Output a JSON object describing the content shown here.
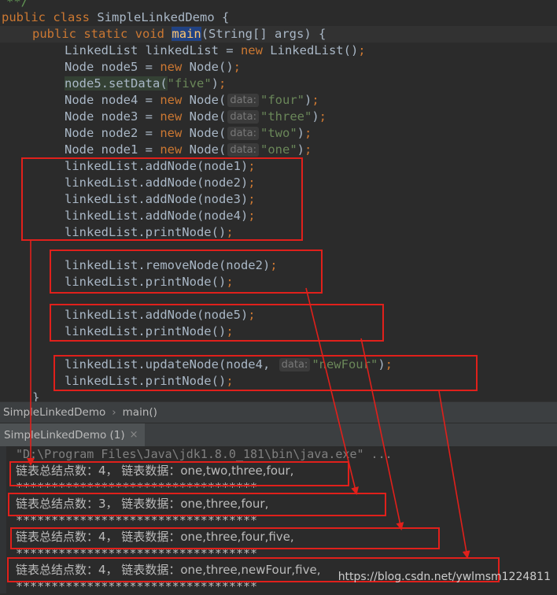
{
  "editor": {
    "comment_tail": "**/",
    "class_decl": {
      "kw1": "public",
      "kw2": "class",
      "name": "SimpleLinkedDemo",
      "brace": "{"
    },
    "main_decl": {
      "kw1": "public",
      "kw2": "static",
      "kw3": "void",
      "name": "main",
      "params": "(String[] args) {"
    },
    "lines": {
      "l1": {
        "pre": "LinkedList linkedList = ",
        "kw": "new",
        "post": " LinkedList()",
        "semi": ";"
      },
      "l2": {
        "pre": "Node node5 = ",
        "kw": "new",
        "post": " Node()",
        "semi": ";"
      },
      "l3": {
        "pre": "node5.setData(",
        "str": "\"five\"",
        "post": ")",
        "semi": ";"
      },
      "l4": {
        "pre": "Node node4 = ",
        "kw": "new",
        "post": " Node(",
        "hint": "data:",
        "str": "\"four\"",
        "close": ")",
        "semi": ";"
      },
      "l5": {
        "pre": "Node node3 = ",
        "kw": "new",
        "post": " Node(",
        "hint": "data:",
        "str": "\"three\"",
        "close": ")",
        "semi": ";"
      },
      "l6": {
        "pre": "Node node2 = ",
        "kw": "new",
        "post": " Node(",
        "hint": "data:",
        "str": "\"two\"",
        "close": ")",
        "semi": ";"
      },
      "l7": {
        "pre": "Node node1 = ",
        "kw": "new",
        "post": " Node(",
        "hint": "data:",
        "str": "\"one\"",
        "close": ")",
        "semi": ";"
      },
      "l8": {
        "text": "linkedList.addNode(node1)",
        "semi": ";"
      },
      "l9": {
        "text": "linkedList.addNode(node2)",
        "semi": ";"
      },
      "l10": {
        "text": "linkedList.addNode(node3)",
        "semi": ";"
      },
      "l11": {
        "text": "linkedList.addNode(node4)",
        "semi": ";"
      },
      "l12": {
        "text": "linkedList.printNode()",
        "semi": ";"
      },
      "l13": {
        "text": "linkedList.removeNode(node2)",
        "semi": ";"
      },
      "l14": {
        "text": "linkedList.printNode()",
        "semi": ";"
      },
      "l15": {
        "text": "linkedList.addNode(node5)",
        "semi": ";"
      },
      "l16": {
        "text": "linkedList.printNode()",
        "semi": ";"
      },
      "l17": {
        "pre": "linkedList.updateNode(node4,",
        "hint": "data:",
        "str": "\"newFour\"",
        "close": ")",
        "semi": ";"
      },
      "l18": {
        "text": "linkedList.printNode()",
        "semi": ";"
      },
      "l19": {
        "text": "}"
      }
    }
  },
  "breadcrumb": {
    "class_name": "SimpleLinkedDemo",
    "separator": "›",
    "method": "main()"
  },
  "run_tab": {
    "label": "SimpleLinkedDemo (1)",
    "close": "×"
  },
  "console": {
    "cmd": "\"D:\\Program Files\\Java\\jdk1.8.0_181\\bin\\java.exe\" ...",
    "out1": "链表总结点数：4， 链表数据：one,two,three,four,",
    "sep1": "**********************************",
    "out2": "链表总结点数：3， 链表数据：one,three,four,",
    "sep2": "**********************************",
    "out3": "链表总结点数：4， 链表数据：one,three,four,five,",
    "sep3": "**********************************",
    "out4": "链表总结点数：4， 链表数据：one,three,newFour,five,",
    "sep4": "**********************************"
  },
  "watermark": "https://blog.csdn.net/ywlmsm1224811",
  "colors": {
    "annotation_red": "#e0201b",
    "editor_bg": "#2b2b2b",
    "keyword": "#cc7832",
    "string": "#6a8759",
    "method": "#ffc66d"
  }
}
